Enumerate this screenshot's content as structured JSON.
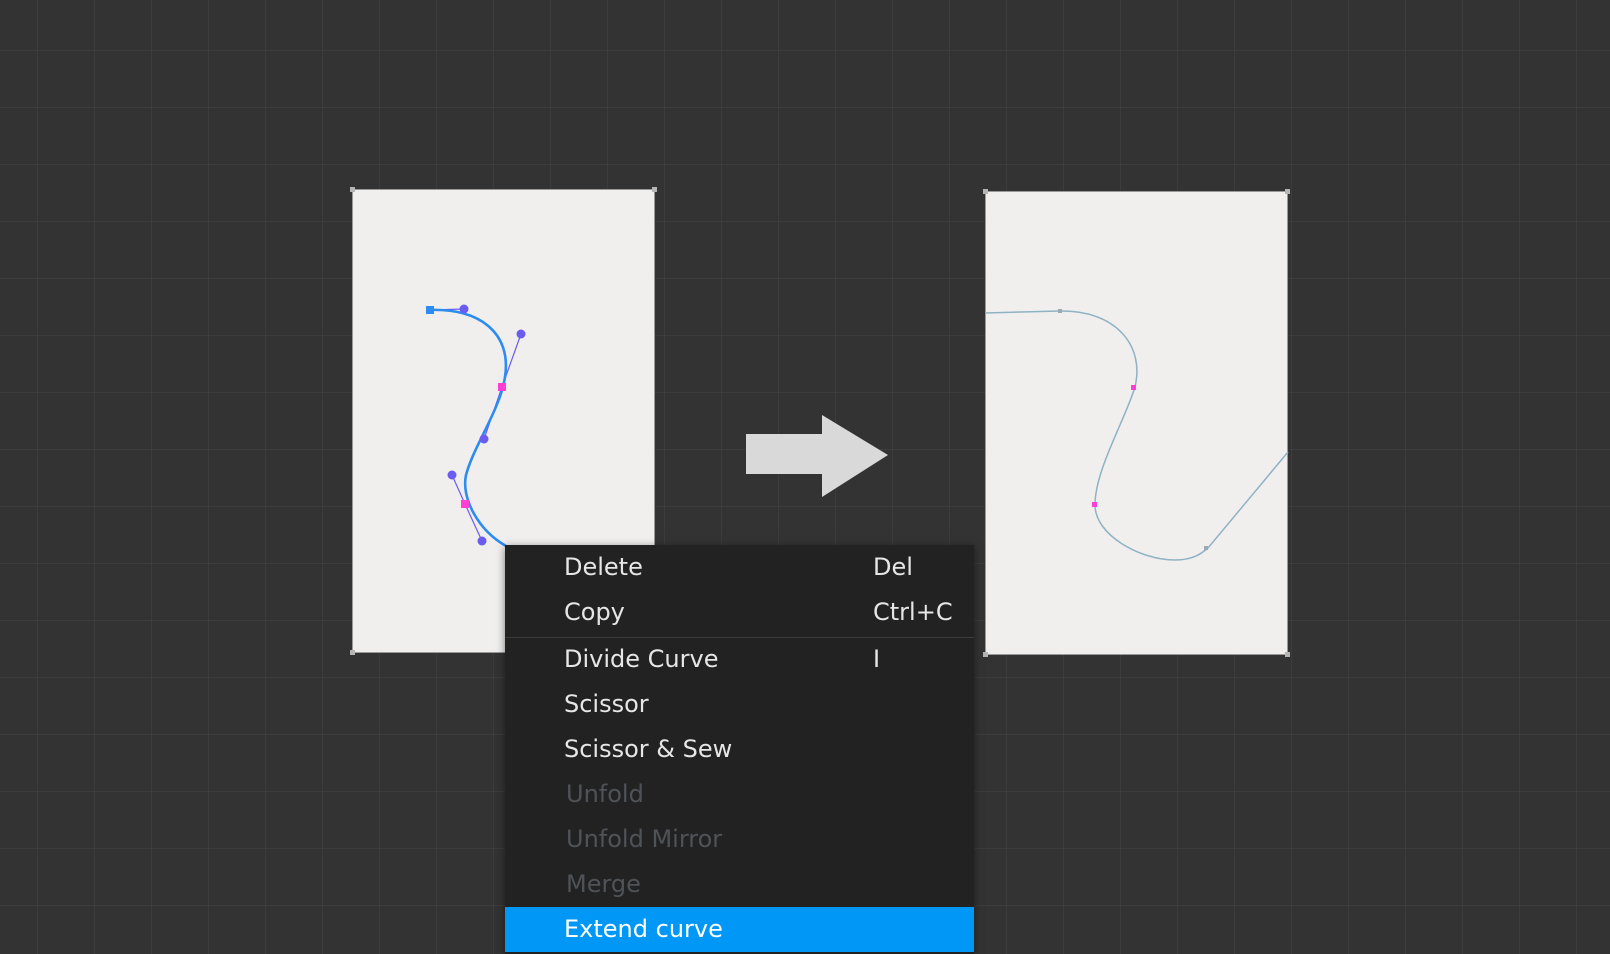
{
  "context_menu": {
    "items": [
      {
        "label": "Delete",
        "shortcut": "Del",
        "state": "enabled"
      },
      {
        "label": "Copy",
        "shortcut": "Ctrl+C",
        "state": "enabled"
      },
      {
        "label": "Divide Curve",
        "shortcut": "I",
        "state": "enabled"
      },
      {
        "label": "Scissor",
        "shortcut": "",
        "state": "enabled"
      },
      {
        "label": "Scissor & Sew",
        "shortcut": "",
        "state": "enabled"
      },
      {
        "label": "Unfold",
        "shortcut": "",
        "state": "disabled"
      },
      {
        "label": "Unfold Mirror",
        "shortcut": "",
        "state": "disabled"
      },
      {
        "label": "Merge",
        "shortcut": "",
        "state": "disabled"
      },
      {
        "label": "Extend curve",
        "shortcut": "",
        "state": "highlighted"
      }
    ]
  },
  "colors": {
    "canvas_background": "#333333",
    "panel_background": "#f0efee",
    "menu_background": "#222222",
    "menu_highlight": "#0097f6",
    "menu_text": "#e6e6e6",
    "menu_text_disabled": "#4f5358",
    "selected_curve": "#2d8cf0",
    "control_handle": "#6b5cf0",
    "curve_anchor": "#ff3fd4",
    "extended_curve": "#8fb2c4",
    "arrow": "#d9d9d9"
  },
  "icons": {
    "transition_arrow": "arrow-right-icon"
  }
}
